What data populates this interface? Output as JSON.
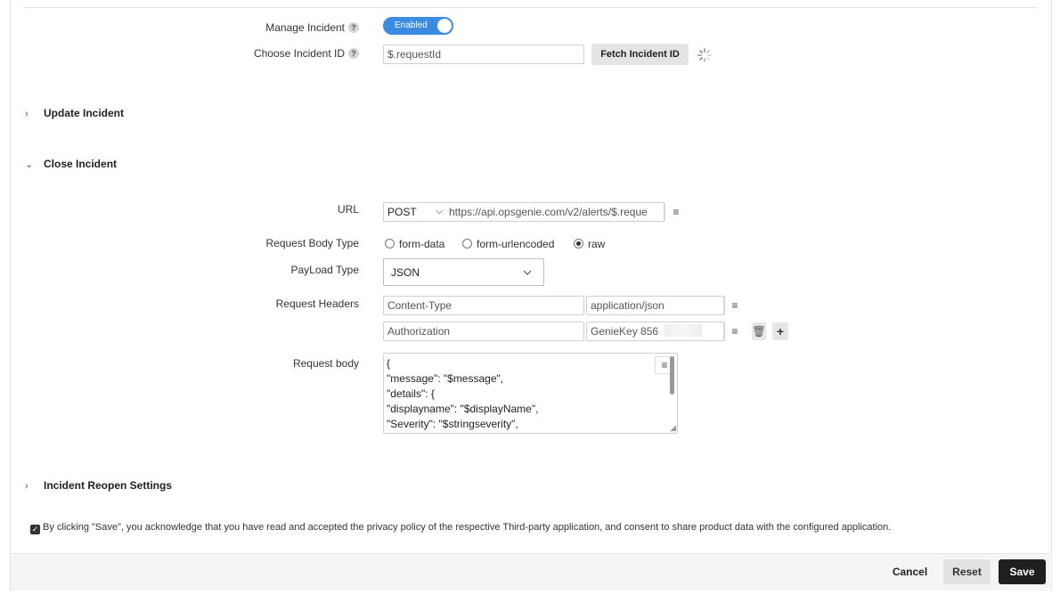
{
  "manage_incident": {
    "label": "Manage Incident",
    "help": "?",
    "toggle_label": "Enabled"
  },
  "choose_incident": {
    "label": "Choose Incident ID",
    "help": "?",
    "value": "$.requestId",
    "fetch_label": "Fetch Incident ID"
  },
  "sections": {
    "update": "Update Incident",
    "close": "Close Incident",
    "reopen": "Incident Reopen Settings"
  },
  "url": {
    "label": "URL",
    "method": "POST",
    "value": "https://api.opsgenie.com/v2/alerts/$.reque"
  },
  "body_type": {
    "label": "Request Body Type",
    "options": [
      "form-data",
      "form-urlencoded",
      "raw"
    ],
    "selected": "raw"
  },
  "payload": {
    "label": "PayLoad Type",
    "value": "JSON"
  },
  "headers": {
    "label": "Request Headers",
    "rows": [
      {
        "key": "Content-Type",
        "value": "application/json"
      },
      {
        "key": "Authorization",
        "value": "GenieKey 856"
      }
    ]
  },
  "request_body": {
    "label": "Request body",
    "lines": [
      "{",
      "\"message\": \"$message\",",
      "\"details\": {",
      "\"displayname\": \"$displayName\",",
      "\"Severity\": \"$stringseverity\","
    ]
  },
  "consent_text": "By clicking \"Save\", you acknowledge that you have read and accepted the privacy policy of the respective Third-party application, and consent to share product data with the configured application.",
  "footer": {
    "cancel": "Cancel",
    "reset": "Reset",
    "save": "Save"
  },
  "colors": {
    "accent": "#3b8be3",
    "save_bg": "#1f1f1f"
  }
}
